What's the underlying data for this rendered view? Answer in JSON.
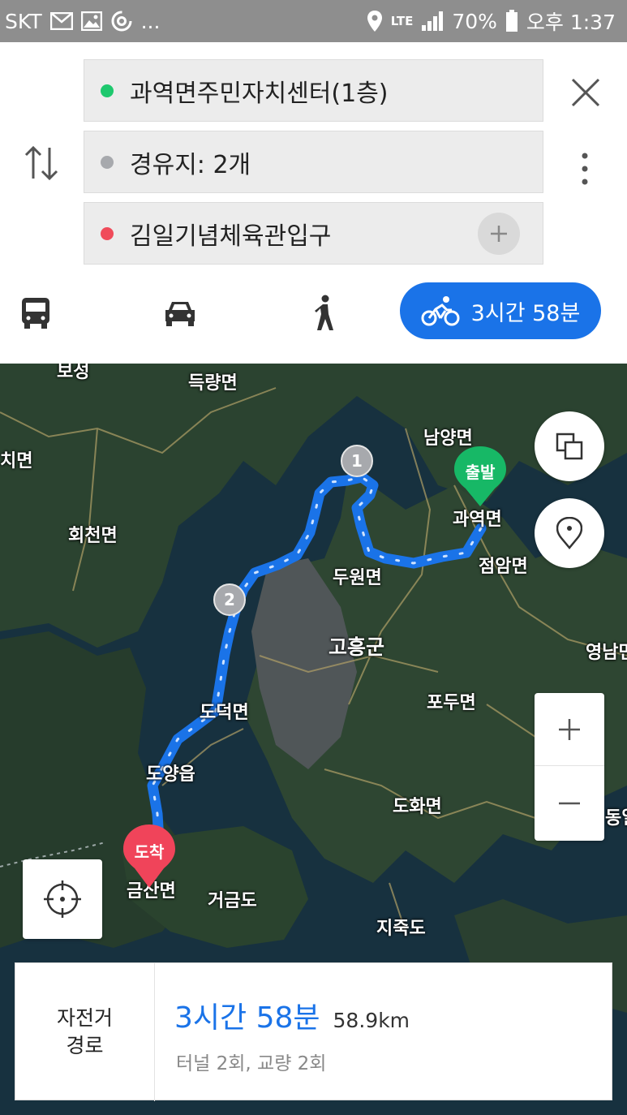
{
  "status_bar": {
    "carrier": "SKT",
    "more": "...",
    "network": "LTE",
    "battery": "70%",
    "time": "오후 1:37"
  },
  "route": {
    "origin": "과역면주민자치센터(1층)",
    "waypoints": "경유지: 2개",
    "destination": "김일기념체육관입구",
    "colors": {
      "origin": "#1ec86e",
      "waypoint": "#a7a9ad",
      "destination": "#f04b5a",
      "accent": "#1a73e8"
    }
  },
  "modes": {
    "active": "bicycle",
    "bicycle_time": "3시간 58분"
  },
  "map": {
    "labels": [
      "득량면",
      "남양면",
      "회천면",
      "과역면",
      "두원면",
      "점암면",
      "고흥군",
      "영남면",
      "도덕면",
      "포두면",
      "도양읍",
      "도화면",
      "동일",
      "금산면",
      "거금도",
      "지죽도",
      "치면",
      "보성"
    ],
    "start_pin": "출발",
    "end_pin": "도착",
    "waypoint_1": "1",
    "waypoint_2": "2"
  },
  "summary": {
    "type_line1": "자전거",
    "type_line2": "경로",
    "time": "3시간 58분",
    "distance": "58.9km",
    "details": "터널 2회, 교량 2회"
  }
}
